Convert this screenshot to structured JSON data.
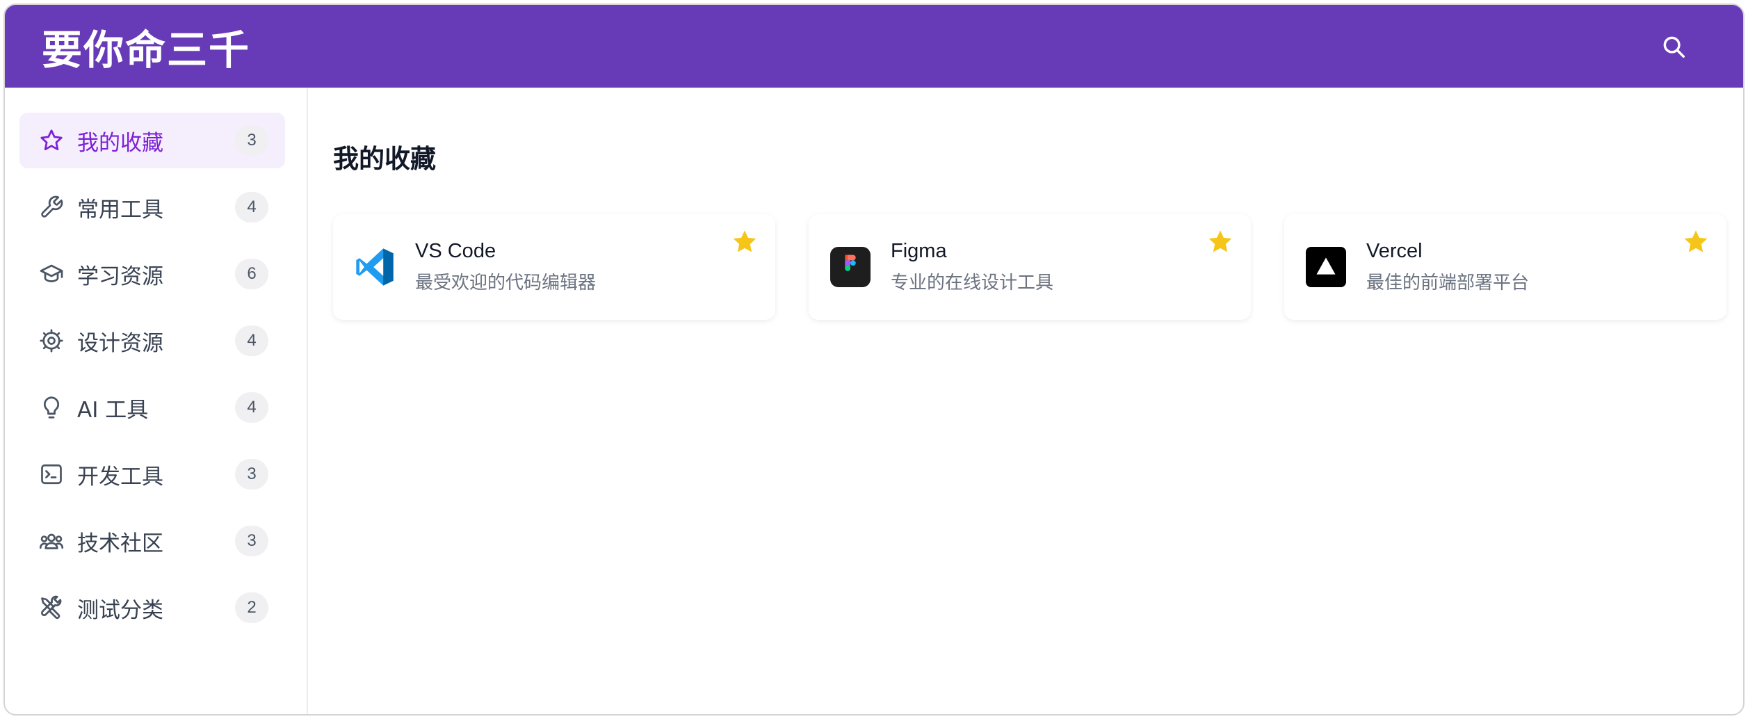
{
  "header": {
    "title": "要你命三千",
    "search_icon": "search-icon"
  },
  "sidebar": {
    "items": [
      {
        "icon": "star-icon",
        "label": "我的收藏",
        "count": "3",
        "active": true
      },
      {
        "icon": "wrench-icon",
        "label": "常用工具",
        "count": "4"
      },
      {
        "icon": "graduation-cap-icon",
        "label": "学习资源",
        "count": "6"
      },
      {
        "icon": "gear-icon",
        "label": "设计资源",
        "count": "4"
      },
      {
        "icon": "lightbulb-icon",
        "label": "AI 工具",
        "count": "4"
      },
      {
        "icon": "terminal-icon",
        "label": "开发工具",
        "count": "3"
      },
      {
        "icon": "users-icon",
        "label": "技术社区",
        "count": "3"
      },
      {
        "icon": "tools-icon",
        "label": "测试分类",
        "count": "2"
      }
    ]
  },
  "main": {
    "section_title": "我的收藏",
    "cards": [
      {
        "name": "VS Code",
        "desc": "最受欢迎的代码编辑器",
        "logo": "vscode-logo-icon",
        "starred": true
      },
      {
        "name": "Figma",
        "desc": "专业的在线设计工具",
        "logo": "figma-logo-icon",
        "starred": true
      },
      {
        "name": "Vercel",
        "desc": "最佳的前端部署平台",
        "logo": "vercel-logo-icon",
        "starred": true
      }
    ]
  },
  "colors": {
    "header_bg": "#673ab7",
    "active_text": "#7c1fd6",
    "active_bg": "#f5eefc",
    "star": "#f5c518"
  }
}
